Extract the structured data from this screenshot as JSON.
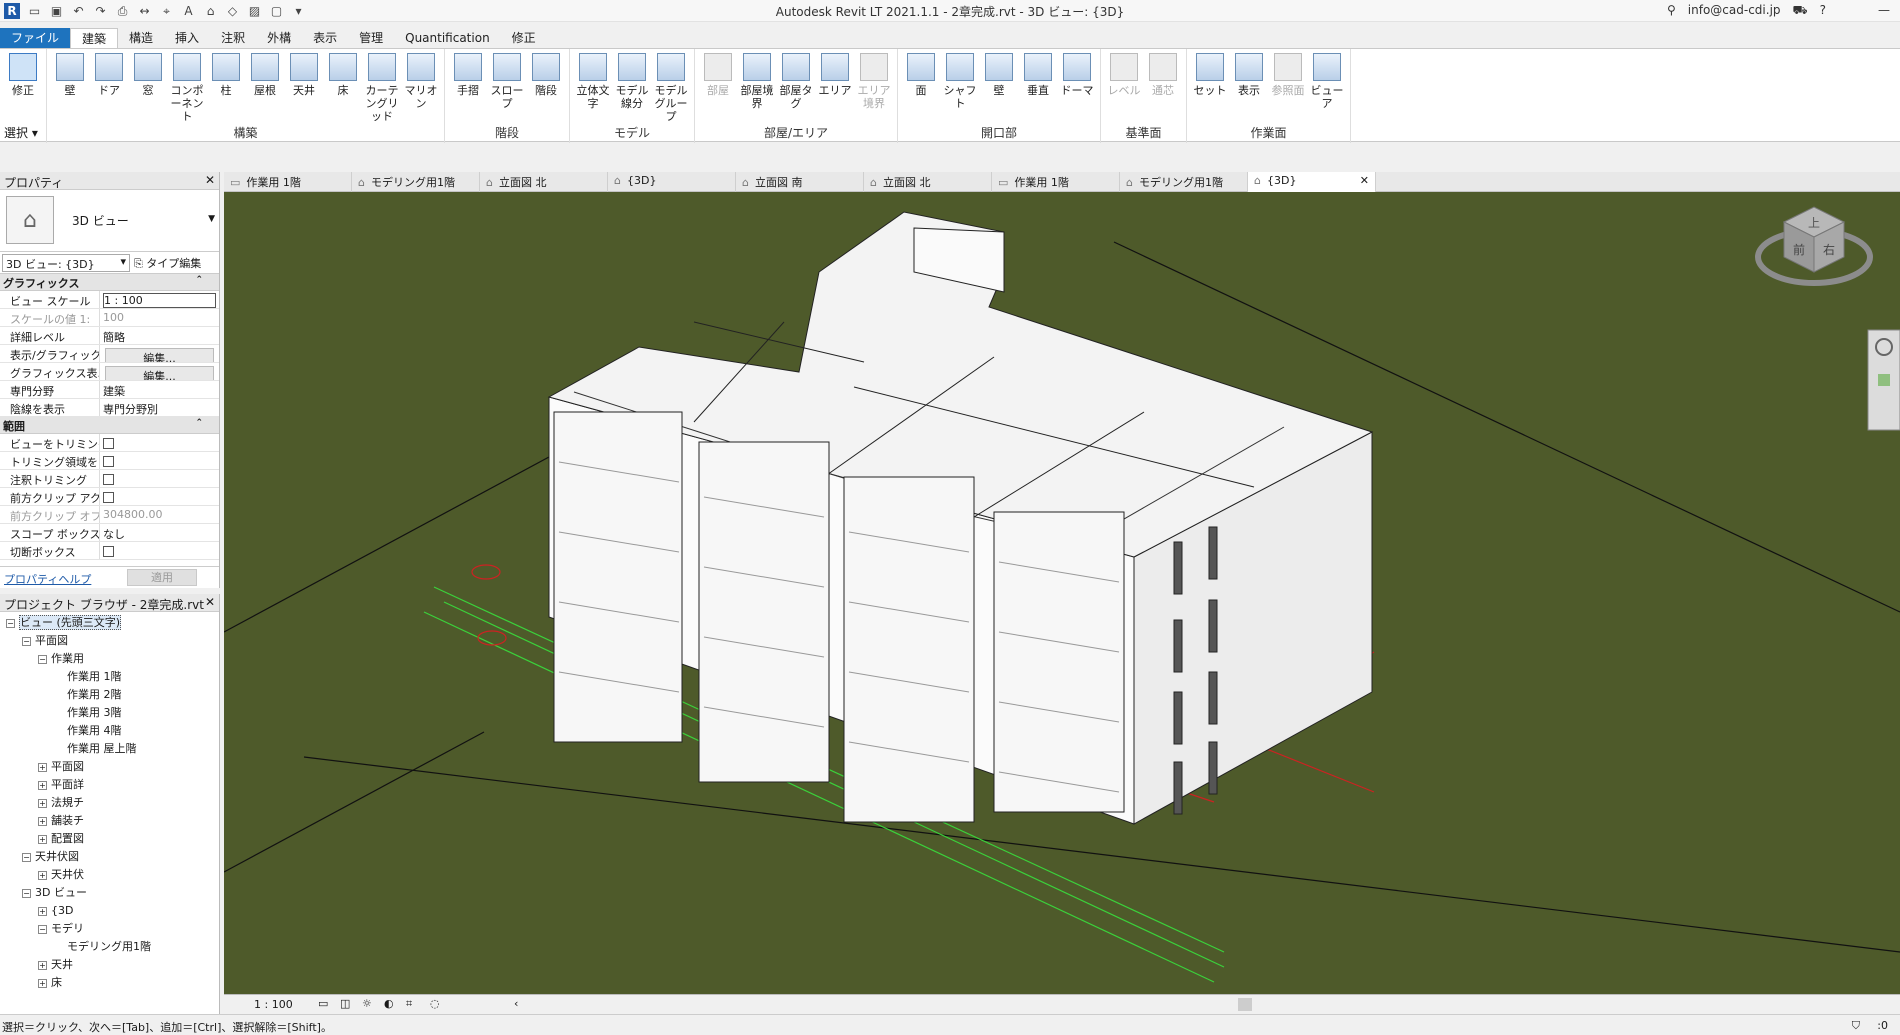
{
  "app": {
    "title": "Autodesk Revit LT 2021.1.1 - 2章完成.rvt - 3D ビュー: {3D}",
    "user": "info@cad-cdi.jp",
    "logo": "R"
  },
  "ribbon_tabs": [
    {
      "label": "ファイル"
    },
    {
      "label": "建築"
    },
    {
      "label": "構造"
    },
    {
      "label": "挿入"
    },
    {
      "label": "注釈"
    },
    {
      "label": "外構"
    },
    {
      "label": "表示"
    },
    {
      "label": "管理"
    },
    {
      "label": "Quantification"
    },
    {
      "label": "修正"
    }
  ],
  "ribbon": {
    "select_label": "選択",
    "panels": [
      {
        "title": "",
        "buttons": [
          "修正"
        ]
      },
      {
        "title": "構築",
        "buttons": [
          "壁",
          "ドア",
          "窓",
          "コンポーネント",
          "柱",
          "屋根",
          "天井",
          "床",
          "カーテングリッド",
          "マリオン"
        ]
      },
      {
        "title": "階段",
        "buttons": [
          "手摺",
          "スロープ",
          "階段"
        ]
      },
      {
        "title": "モデル",
        "buttons": [
          "立体文字",
          "モデル線分",
          "モデルグループ"
        ]
      },
      {
        "title": "部屋/エリア",
        "buttons": [
          "部屋",
          "部屋境界",
          "部屋タグ",
          "エリア",
          "エリア境界"
        ]
      },
      {
        "title": "開口部",
        "buttons": [
          "面",
          "シャフト",
          "壁",
          "垂直",
          "ドーマ"
        ]
      },
      {
        "title": "基準面",
        "buttons": [
          "レベル",
          "通芯"
        ]
      },
      {
        "title": "作業面",
        "buttons": [
          "セット",
          "表示",
          "参照面",
          "ビューア"
        ]
      }
    ]
  },
  "properties": {
    "header": "プロパティ",
    "close": "✕",
    "type_name": "3D ビュー",
    "selector": "3D ビュー: {3D}",
    "edit_type": "タイプ編集",
    "graphics_group": "グラフィックス",
    "rows": [
      {
        "k": "ビュー スケール",
        "v": "1 : 100"
      },
      {
        "k": "スケールの値  1:",
        "v": "100"
      },
      {
        "k": "詳細レベル",
        "v": "簡略"
      },
      {
        "k": "表示/グラフィック...",
        "v": "編集..."
      },
      {
        "k": "グラフィックス表...",
        "v": "編集..."
      },
      {
        "k": "専門分野",
        "v": "建築"
      },
      {
        "k": "陰線を表示",
        "v": "専門分野別"
      }
    ],
    "extent_group": "範囲",
    "extent_rows": [
      {
        "k": "ビューをトリミング",
        "v": ""
      },
      {
        "k": "トリミング領域を...",
        "v": ""
      },
      {
        "k": "注釈トリミング",
        "v": ""
      },
      {
        "k": "前方クリップ アク...",
        "v": ""
      },
      {
        "k": "前方クリップ オフ...",
        "v": "304800.00"
      },
      {
        "k": "スコープ ボックス",
        "v": "なし"
      },
      {
        "k": "切断ボックス",
        "v": ""
      }
    ],
    "help": "プロパティヘルプ",
    "apply": "適用"
  },
  "browser": {
    "header": "プロジェクト ブラウザ - 2章完成.rvt",
    "close": "✕",
    "items": [
      {
        "label": "ビュー (先頭三文字)",
        "level": 0,
        "toggle": "−"
      },
      {
        "label": "平面図",
        "level": 1,
        "toggle": "−"
      },
      {
        "label": "作業用",
        "level": 2,
        "toggle": "−"
      },
      {
        "label": "作業用 1階",
        "level": 3,
        "toggle": ""
      },
      {
        "label": "作業用 2階",
        "level": 3,
        "toggle": ""
      },
      {
        "label": "作業用 3階",
        "level": 3,
        "toggle": ""
      },
      {
        "label": "作業用 4階",
        "level": 3,
        "toggle": ""
      },
      {
        "label": "作業用 屋上階",
        "level": 3,
        "toggle": ""
      },
      {
        "label": "平面図",
        "level": 2,
        "toggle": "+"
      },
      {
        "label": "平面詳",
        "level": 2,
        "toggle": "+"
      },
      {
        "label": "法規チ",
        "level": 2,
        "toggle": "+"
      },
      {
        "label": "舗装チ",
        "level": 2,
        "toggle": "+"
      },
      {
        "label": "配置図",
        "level": 2,
        "toggle": "+"
      },
      {
        "label": "天井伏図",
        "level": 1,
        "toggle": "−"
      },
      {
        "label": "天井伏",
        "level": 2,
        "toggle": "+"
      },
      {
        "label": "3D ビュー",
        "level": 1,
        "toggle": "−"
      },
      {
        "label": "{3D",
        "level": 2,
        "toggle": "+"
      },
      {
        "label": "モデリ",
        "level": 2,
        "toggle": "−"
      },
      {
        "label": "モデリング用1階",
        "level": 3,
        "toggle": ""
      },
      {
        "label": "天井",
        "level": 2,
        "toggle": "+"
      },
      {
        "label": "床",
        "level": 2,
        "toggle": "+"
      }
    ]
  },
  "view_tabs": [
    {
      "label": "作業用 1階",
      "icon": "▭"
    },
    {
      "label": "モデリング用1階",
      "icon": "⌂"
    },
    {
      "label": "立面図 北",
      "icon": "⌂"
    },
    {
      "label": "{3D}",
      "icon": "⌂"
    },
    {
      "label": "立面図 南",
      "icon": "⌂"
    },
    {
      "label": "立面図 北",
      "icon": "⌂"
    },
    {
      "label": "作業用 1階",
      "icon": "▭"
    },
    {
      "label": "モデリング用1階",
      "icon": "⌂"
    },
    {
      "label": "{3D}",
      "icon": "⌂"
    }
  ],
  "viewcube": {
    "top": "上",
    "front": "前",
    "right": "右"
  },
  "view_bar": {
    "scale": "1 : 100"
  },
  "status": {
    "text": "選択＝クリック、次へ＝[Tab]、追加＝[Ctrl]、選択解除＝[Shift]。",
    "filter": ":0"
  },
  "colors": {
    "viewport_bg": "#4e5a2a",
    "accent": "#1e73be"
  }
}
